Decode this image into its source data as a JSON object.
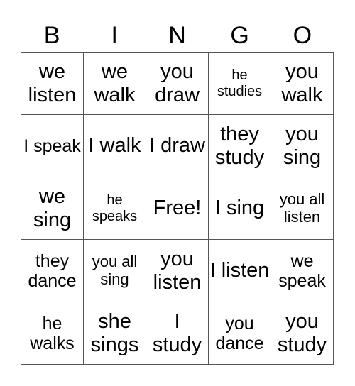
{
  "header": {
    "letters": [
      "B",
      "I",
      "N",
      "G",
      "O"
    ]
  },
  "card": {
    "cells": [
      {
        "text": "we listen",
        "size": "lg"
      },
      {
        "text": "we walk",
        "size": "lg"
      },
      {
        "text": "you draw",
        "size": "lg"
      },
      {
        "text": "he studies",
        "size": "xs"
      },
      {
        "text": "you walk",
        "size": "lg"
      },
      {
        "text": "I speak",
        "size": "md"
      },
      {
        "text": "I walk",
        "size": "lg"
      },
      {
        "text": "I draw",
        "size": "lg"
      },
      {
        "text": "they study",
        "size": "lg"
      },
      {
        "text": "you sing",
        "size": "lg"
      },
      {
        "text": "we sing",
        "size": "lg"
      },
      {
        "text": "he speaks",
        "size": "xs"
      },
      {
        "text": "Free!",
        "size": "lg"
      },
      {
        "text": "I sing",
        "size": "lg"
      },
      {
        "text": "you all listen",
        "size": "sm"
      },
      {
        "text": "they dance",
        "size": "md"
      },
      {
        "text": "you all sing",
        "size": "sm"
      },
      {
        "text": "you listen",
        "size": "lg"
      },
      {
        "text": "I listen",
        "size": "lg"
      },
      {
        "text": "we speak",
        "size": "md"
      },
      {
        "text": "he walks",
        "size": "md"
      },
      {
        "text": "she sings",
        "size": "lg"
      },
      {
        "text": "I study",
        "size": "lg"
      },
      {
        "text": "you dance",
        "size": "md"
      },
      {
        "text": "you study",
        "size": "lg"
      }
    ]
  }
}
